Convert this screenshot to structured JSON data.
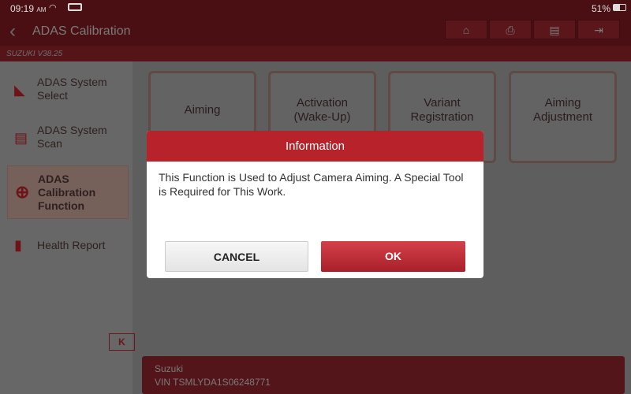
{
  "status": {
    "time": "09:19",
    "ampm": "AM",
    "battery": "51%",
    "battery_level": 0.51
  },
  "header": {
    "title": "ADAS Calibration",
    "buttons": [
      {
        "name": "home",
        "icon": "⌂"
      },
      {
        "name": "print",
        "icon": "⎙"
      },
      {
        "name": "report",
        "icon": "▤"
      },
      {
        "name": "exit",
        "icon": "⇥"
      }
    ]
  },
  "subbar": {
    "version": "SUZUKI V38.25"
  },
  "sidebar": {
    "items": [
      {
        "label": "ADAS System Select",
        "icon": "cursor-icon"
      },
      {
        "label": "ADAS System Scan",
        "icon": "scan-icon"
      },
      {
        "label": "ADAS Calibration Function",
        "icon": "target-icon",
        "selected": true
      },
      {
        "label": "Health Report",
        "icon": "clipboard-icon"
      }
    ],
    "collapse": "K"
  },
  "tiles": [
    "Aiming",
    "Activation (Wake-Up)",
    "Variant Registration",
    "Aiming Adjustment"
  ],
  "vehicle": {
    "make": "Suzuki",
    "vin": "VIN TSMLYDA1S06248771"
  },
  "dialog": {
    "title": "Information",
    "message": "This Function is Used to Adjust Camera Aiming. A Special Tool is Required for This Work.",
    "cancel": "CANCEL",
    "ok": "OK"
  }
}
